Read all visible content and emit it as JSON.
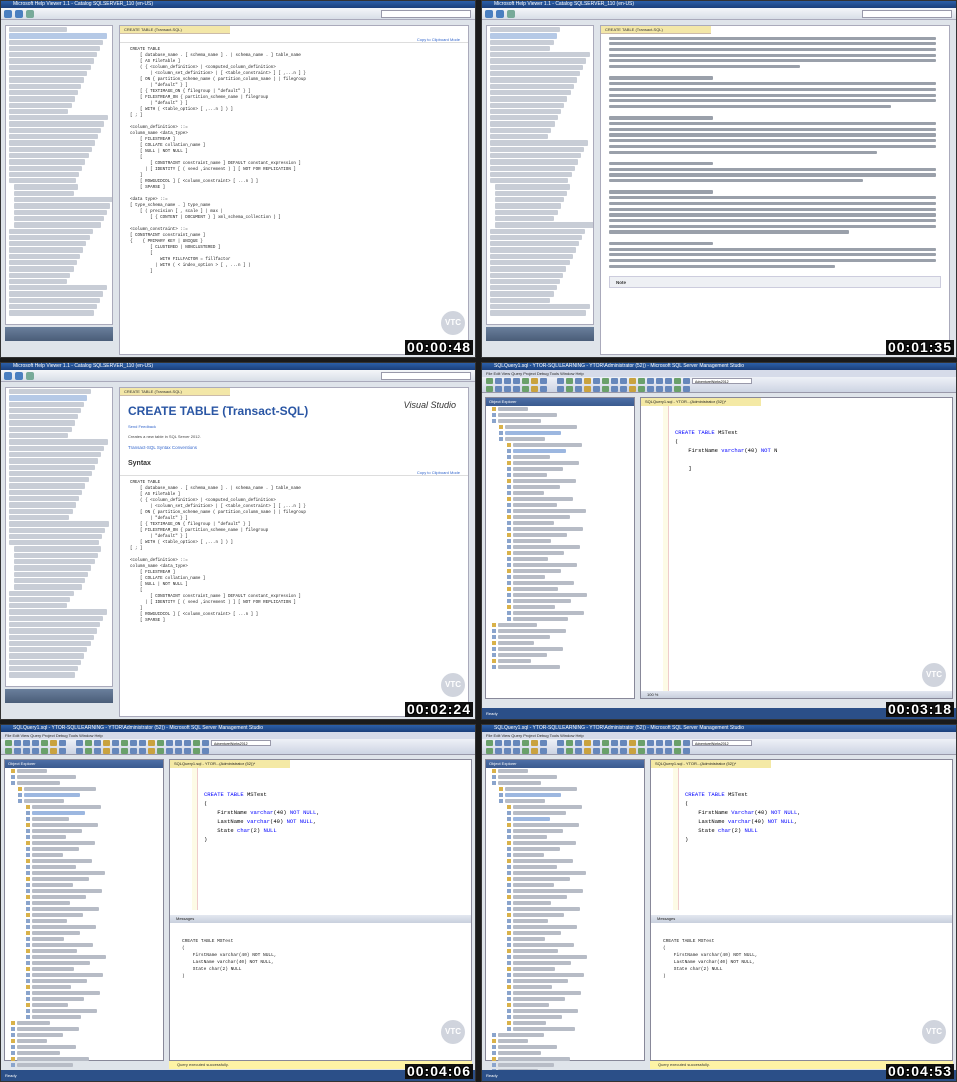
{
  "window": {
    "help_title": "Microsoft Help Viewer 1.1 - Catalog SQLSERVER_110 (en-US)",
    "ssms_title": "SQLQuery1.sql - YTOR-SQL\\LEARNING - YTOR\\Administrator (52)) - Microsoft SQL Server Management Studio"
  },
  "help": {
    "tab_label": "CREATE TABLE (Transact-SQL)",
    "copy_link": "Copy to Clipboard Mode",
    "title": "CREATE TABLE (Transact-SQL)",
    "logo": "Visual Studio",
    "send_feedback": "Send Feedback",
    "applies_text": "Creates a new table in SQL Server 2012.",
    "conventions_link": "Transact-SQL Syntax Conventions",
    "syntax_heading": "Syntax",
    "code_frame1": "CREATE TABLE\n    [ database_name . [ schema_name ] . | schema_name . ] table_name\n    [ AS FileTable ]\n    ( { <column_definition> | <computed_column_definition>\n        | <column_set_definition> | [ <table_constraint> ] [ ,...n ] }\n    [ ON { partition_scheme_name ( partition_column_name ) | filegroup\n        | \"default\" } ]\n    [ { TEXTIMAGE_ON { filegroup | \"default\" } ]\n    [ FILESTREAM_ON { partition_scheme_name | filegroup\n        | \"default\" } ]\n    [ WITH ( <table_option> [ ,...n ] ) ]\n[ ; ]\n\n<column_definition> ::=\ncolumn_name <data_type>\n    [ FILESTREAM ]\n    [ COLLATE collation_name ]\n    [ NULL | NOT NULL ]\n    [\n        [ CONSTRAINT constraint_name ] DEFAULT constant_expression ]\n      | [ IDENTITY [ ( seed ,increment ) ] [ NOT FOR REPLICATION ]\n    ]\n    [ ROWGUIDCOL ] [ <column_constraint> [ ...n ] ]\n    [ SPARSE ]\n\n<data type> ::=\n[ type_schema_name . ] type_name\n    [ ( precision [ , scale ] | max |\n        [ { CONTENT | DOCUMENT } ] xml_schema_collection ) ]\n\n<column_constraint> ::=\n[ CONSTRAINT constraint_name ]\n{    { PRIMARY KEY | UNIQUE }\n        [ CLUSTERED | NONCLUSTERED ]\n        [\n            WITH FILLFACTOR = fillfactor\n          | WITH ( < index_option > [ , ...n ] )\n        ]",
    "code_frame3": "CREATE TABLE\n    [ database_name . [ schema_name ] . | schema_name . ] table_name\n    [ AS FileTable ]\n    ( { <column_definition> | <computed_column_definition>\n        | <column_set_definition> | [ <table_constraint> ] [ ,...n ] }\n    [ ON { partition_scheme_name ( partition_column_name ) | filegroup\n        | \"default\" } ]\n    [ { TEXTIMAGE_ON { filegroup | \"default\" } ]\n    [ FILESTREAM_ON { partition_scheme_name | filegroup\n        | \"default\" } ]\n    [ WITH ( <table_option> [ ,...n ] ) ]\n[ ; ]\n\n<column_definition> ::=\ncolumn_name <data_type>\n    [ FILESTREAM ]\n    [ COLLATE collation_name ]\n    [ NULL | NOT NULL ]\n    [\n        [ CONSTRAINT constraint_name ] DEFAULT constant_expression ]\n      | [ IDENTITY [ ( seed ,increment ) ] [ NOT FOR REPLICATION ]\n    ]\n    [ ROWGUIDCOL ] [ <column_constraint> [ ...n ] ]\n    [ SPARSE ]",
    "persisted_heading": "PERSISTED",
    "on_heading": "ON { partition_scheme | filegroup | \"default\" }",
    "note_label": "Note"
  },
  "ssms": {
    "menu": "File  Edit  View  Query  Project  Debug  Tools  Window  Help",
    "oe_header": "Object Explorer",
    "editor_tab": "SQLQuery1.sql - YTOR...(Administrator (52))*",
    "messages_tab": "Messages",
    "zoom": "100 %",
    "status": "Query executed successfully.",
    "server": "YTOR-SQL\\LEARN",
    "db": "AdventureWorks2012",
    "statusbar": "Ready",
    "frame4_code": "\n\nCREATE TABLE MSTest\n(\n    FirstName varchar(40) NOT N\n\n    ]\n",
    "frame5_code": "\n\nCREATE TABLE MSTest\n(\n    FirstName varchar(40) NOT NULL,\n    LastName varchar(40) NOT NULL,\n    State char(2) NULL\n)\n",
    "frame6_code": "\n\nCREATE TABLE MSTest\n(\n    FirstName Varchar(40) NOT NULL,\n    LastName varchar(40) NOT NULL,\n    State char(2) NULL\n)\n",
    "messages_code": "CREATE TABLE MSTest\n(\n    FirstName varchar(40) NOT NULL,\n    LastName varchar(40) NOT NULL,\n    State char(2) NULL\n)"
  },
  "badge": "VTC",
  "timestamps": [
    "00:00:48",
    "00:01:35",
    "00:02:24",
    "00:03:18",
    "00:04:06",
    "00:04:53"
  ]
}
